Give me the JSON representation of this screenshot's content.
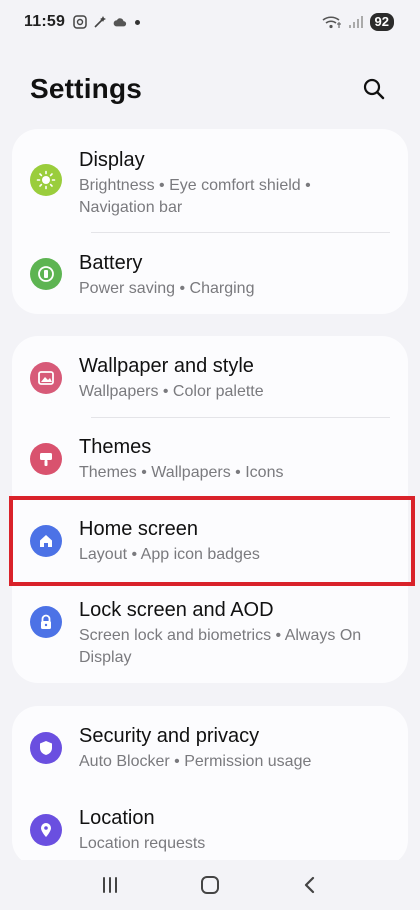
{
  "status_bar": {
    "time": "11:59",
    "battery": "92",
    "icons": [
      "screenshot-icon",
      "magic-wand-icon",
      "cloud-icon",
      "dot-icon",
      "wifi-icon",
      "signal-icon",
      "battery-icon"
    ]
  },
  "header": {
    "title": "Settings",
    "search_icon": "search-icon"
  },
  "groups": [
    {
      "items": [
        {
          "title": "Display",
          "subtitle_line1": "Brightness  •  Eye comfort shield  •",
          "subtitle_line2": "Navigation bar",
          "icon": "sun-icon",
          "icon_color": "#9acd3c"
        },
        {
          "title": "Battery",
          "subtitle_line1": "Power saving  •  Charging",
          "icon": "battery-charge-icon",
          "icon_color": "#5db452"
        }
      ]
    },
    {
      "items": [
        {
          "title": "Wallpaper and style",
          "subtitle_line1": "Wallpapers  •  Color palette",
          "icon": "image-icon",
          "icon_color": "#d75a78"
        },
        {
          "title": "Themes",
          "subtitle_line1": "Themes  •  Wallpapers  •  Icons",
          "icon": "brush-icon",
          "icon_color": "#d9526e"
        },
        {
          "title": "Home screen",
          "subtitle_line1": "Layout  •  App icon badges",
          "icon": "home-icon",
          "icon_color": "#4c72e6"
        },
        {
          "title": "Lock screen and AOD",
          "subtitle_line1": "Screen lock and biometrics  •  Always On",
          "subtitle_line2": "Display",
          "icon": "lock-icon",
          "icon_color": "#4c72e6"
        }
      ]
    },
    {
      "items": [
        {
          "title": "Security and privacy",
          "subtitle_line1": "Auto Blocker  •  Permission usage",
          "icon": "shield-icon",
          "icon_color": "#6a4fe0"
        },
        {
          "title": "Location",
          "subtitle_line1": "Location requests",
          "icon": "location-pin-icon",
          "icon_color": "#6a4fe0"
        }
      ]
    }
  ],
  "nav_bar": {
    "icons": [
      "recent-apps-icon",
      "home-nav-icon",
      "back-icon"
    ]
  },
  "highlight_color": "#d9222a"
}
